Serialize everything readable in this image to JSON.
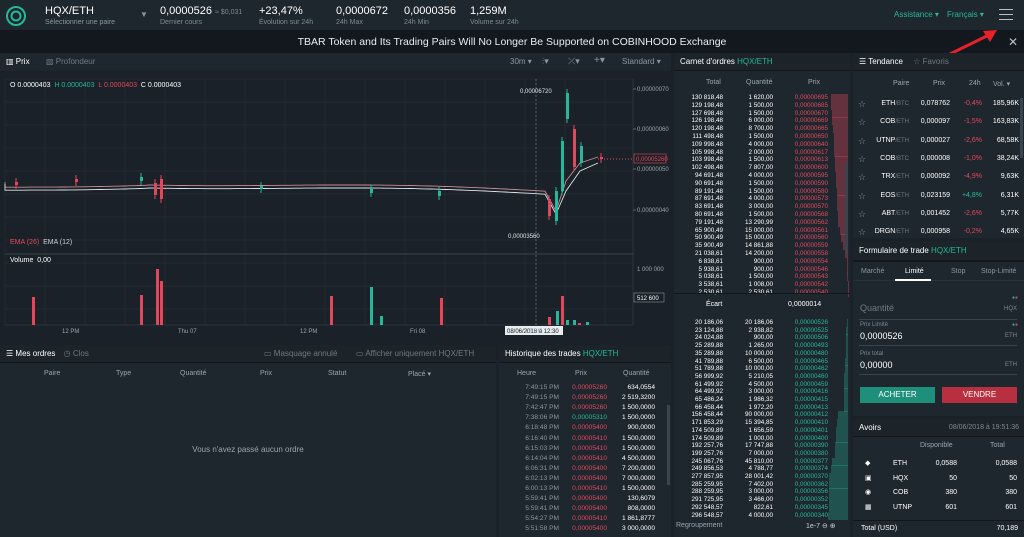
{
  "header": {
    "pair": "HQX/ETH",
    "pair_sub": "Sélectionner une paire",
    "last_price": "0,0000526",
    "last_usd": "≈ $0,031",
    "last_label": "Dernier cours",
    "change": "+23,47%",
    "change_label": "Évolution sur 24h",
    "high": "0,0000672",
    "high_label": "24h Max",
    "low": "0,0000356",
    "low_label": "24h Min",
    "volume": "1,259M",
    "volume_label": "Volume sur 24h",
    "assistance": "Assistance",
    "language": "Français"
  },
  "banner": {
    "text": "TBAR Token and Its Trading Pairs Will No Longer Be Supported on COBINHOOD Exchange",
    "close": "✕"
  },
  "chart": {
    "tab_price": "Prix",
    "tab_depth": "Profondeur",
    "interval": "30m",
    "style": "Standard",
    "ohlc_o": "O 0.0000403",
    "ohlc_h": "H 0.0000403",
    "ohlc_l": "L 0.0000403",
    "ohlc_c": "C 0.0000403",
    "ema26": "EMA (26)",
    "ema12": "EMA (12)",
    "volume_label": "Volume",
    "volume_value": "0,00",
    "price_ticks": [
      "0,00000070",
      "0,00000060",
      "0,00000050",
      "0,00000040"
    ],
    "volume_ticks": [
      "1 000 000",
      "512 600"
    ],
    "peak_label": "0,00006720",
    "low_label": "0,00003560",
    "last_tag": "0,00005260",
    "time_labels": [
      "12 PM",
      "Thu 07",
      "12 PM",
      "Fri 08",
      "12 PM"
    ],
    "cursor_time": "08/06/2018 à 12:30"
  },
  "chart_data": {
    "type": "bar",
    "title": "",
    "categories": [],
    "series": [],
    "values": []
  },
  "orders": {
    "title": "Mes ordres",
    "closed": "Clos",
    "hide_cancelled": "Masquage annulé",
    "only_pair": "Afficher uniquement HQX/ETH",
    "columns": [
      "Paire",
      "Type",
      "Quantité",
      "Prix",
      "Statut",
      "Placé ▾"
    ],
    "empty": "Vous n'avez passé aucun ordre"
  },
  "trades": {
    "title": "Historique des trades",
    "pair": "HQX/ETH",
    "columns": [
      "Heure",
      "Prix",
      "Quantité"
    ],
    "rows": [
      [
        "7:49:15 PM",
        "0,00005260",
        "634,0554",
        "r"
      ],
      [
        "7:49:15 PM",
        "0,00005260",
        "2 519,3200",
        "r"
      ],
      [
        "7:42:47 PM",
        "0,00005260",
        "1 500,0000",
        "r"
      ],
      [
        "7:38:06 PM",
        "0,00005310",
        "1 500,0000",
        "g"
      ],
      [
        "6:18:48 PM",
        "0,00005400",
        "900,0000",
        "r"
      ],
      [
        "6:16:40 PM",
        "0,00005410",
        "1 500,0000",
        "r"
      ],
      [
        "6:15:03 PM",
        "0,00005410",
        "1 500,0000",
        "r"
      ],
      [
        "6:14:04 PM",
        "0,00005410",
        "4 500,0000",
        "r"
      ],
      [
        "6:06:31 PM",
        "0,00005400",
        "7 200,0000",
        "r"
      ],
      [
        "6:02:13 PM",
        "0,00005400",
        "7 000,0000",
        "r"
      ],
      [
        "6:00:13 PM",
        "0,00005410",
        "1 500,0000",
        "r"
      ],
      [
        "5:59:41 PM",
        "0,00005400",
        "130,6079",
        "r"
      ],
      [
        "5:59:41 PM",
        "0,00005400",
        "808,0000",
        "r"
      ],
      [
        "5:54:27 PM",
        "0,00005410",
        "1 861,8777",
        "r"
      ],
      [
        "5:51:58 PM",
        "0,00005400",
        "3 000,0000",
        "r"
      ]
    ]
  },
  "book": {
    "title": "Carnet d'ordres",
    "pair": "HQX/ETH",
    "columns": [
      "Total",
      "Quantité",
      "Prix"
    ],
    "asks": [
      [
        "130 818,48",
        "1 620,00",
        "0,00000695"
      ],
      [
        "129 198,48",
        "1 500,00",
        "0,00000685"
      ],
      [
        "127 698,48",
        "1 500,00",
        "0,00000670"
      ],
      [
        "126 198,48",
        "6 000,00",
        "0,00000669"
      ],
      [
        "120 198,48",
        "8 700,00",
        "0,00000665"
      ],
      [
        "111 498,48",
        "1 500,00",
        "0,00000650"
      ],
      [
        "109 998,48",
        "4 000,00",
        "0,00000640"
      ],
      [
        "105 998,48",
        "2 000,00",
        "0,00000617"
      ],
      [
        "103 998,48",
        "1 500,00",
        "0,00000613"
      ],
      [
        "102 498,48",
        "7 807,00",
        "0,00000600"
      ],
      [
        "94 691,48",
        "4 000,00",
        "0,00000595"
      ],
      [
        "90 691,48",
        "1 500,00",
        "0,00000590"
      ],
      [
        "89 191,48",
        "1 500,00",
        "0,00000580"
      ],
      [
        "87 691,48",
        "4 000,00",
        "0,00000573"
      ],
      [
        "83 691,48",
        "3 000,00",
        "0,00000570"
      ],
      [
        "80 691,48",
        "1 500,00",
        "0,00000568"
      ],
      [
        "79 191,48",
        "13 290,99",
        "0,00000562"
      ],
      [
        "65 900,49",
        "15 000,00",
        "0,00000561"
      ],
      [
        "50 900,49",
        "15 000,00",
        "0,00000560"
      ],
      [
        "35 900,49",
        "14 861,88",
        "0,00000559"
      ],
      [
        "21 038,61",
        "14 200,00",
        "0,00000558"
      ],
      [
        "6 838,61",
        "900,00",
        "0,00000554"
      ],
      [
        "5 938,61",
        "900,00",
        "0,00000546"
      ],
      [
        "5 038,61",
        "1 500,00",
        "0,00000543"
      ],
      [
        "3 538,61",
        "1 008,00",
        "0,00000542"
      ],
      [
        "2 530,61",
        "2 530,61",
        "0,00000540"
      ]
    ],
    "spread_label": "Écart",
    "spread": "0,0000014",
    "bids": [
      [
        "20 186,06",
        "20 186,06",
        "0,00000526"
      ],
      [
        "23 124,88",
        "2 938,82",
        "0,00000525"
      ],
      [
        "24 024,88",
        "900,00",
        "0,00000506"
      ],
      [
        "25 289,88",
        "1 265,00",
        "0,00000493"
      ],
      [
        "35 289,88",
        "10 000,00",
        "0,00000480"
      ],
      [
        "41 789,88",
        "6 500,00",
        "0,00000465"
      ],
      [
        "51 789,88",
        "10 000,00",
        "0,00000462"
      ],
      [
        "56 999,92",
        "5 210,05",
        "0,00000460"
      ],
      [
        "61 499,92",
        "4 500,00",
        "0,00000459"
      ],
      [
        "64 499,92",
        "3 000,00",
        "0,00000416"
      ],
      [
        "65 486,24",
        "1 986,32",
        "0,00000415"
      ],
      [
        "66 458,44",
        "1 972,20",
        "0,00000413"
      ],
      [
        "156 458,44",
        "90 000,00",
        "0,00000412"
      ],
      [
        "171 853,29",
        "15 394,85",
        "0,00000410"
      ],
      [
        "174 509,89",
        "1 656,59",
        "0,00000401"
      ],
      [
        "174 509,89",
        "1 000,00",
        "0,00000400"
      ],
      [
        "192 257,76",
        "17 747,88",
        "0,00000390"
      ],
      [
        "199 257,76",
        "7 000,00",
        "0,00000380"
      ],
      [
        "245 067,76",
        "45 810,00",
        "0,00000377"
      ],
      [
        "249 856,53",
        "4 788,77",
        "0,00000374"
      ],
      [
        "277 857,95",
        "28 001,42",
        "0,00000370"
      ],
      [
        "285 259,95",
        "7 402,00",
        "0,00000362"
      ],
      [
        "288 259,95",
        "3 000,00",
        "0,00000356"
      ],
      [
        "291 725,95",
        "3 466,00",
        "0,00000352"
      ],
      [
        "292 548,57",
        "822,61",
        "0,00000345"
      ],
      [
        "296 548,57",
        "4 000,00",
        "0,00000340"
      ]
    ],
    "grouping_label": "Regroupement",
    "grouping": "1e-7"
  },
  "trend": {
    "title": "Tendance",
    "favorites": "Favoris",
    "columns": [
      "Paire",
      "Prix",
      "24h",
      "Vol. ▾"
    ],
    "rows": [
      [
        "ETH",
        "/BTC",
        "0,078762",
        "-0,4%",
        "185,96K",
        "r"
      ],
      [
        "COB",
        "/ETH",
        "0,000097",
        "-1,5%",
        "163,83K",
        "r"
      ],
      [
        "UTNP",
        "/ETH",
        "0,000027",
        "-2,6%",
        "68,58K",
        "r"
      ],
      [
        "COB",
        "/BTC",
        "0,000008",
        "-1,0%",
        "38,24K",
        "r"
      ],
      [
        "TRX",
        "/ETH",
        "0,000092",
        "-4,9%",
        "9,63K",
        "r"
      ],
      [
        "EOS",
        "/ETH",
        "0,023159",
        "+4,8%",
        "6,31K",
        "g"
      ],
      [
        "ABT",
        "/ETH",
        "0,001452",
        "-2,6%",
        "5,77K",
        "r"
      ],
      [
        "DRGN",
        "/ETH",
        "0,000958",
        "-0,2%",
        "4,65K",
        "r"
      ]
    ]
  },
  "form": {
    "title": "Formulaire de trade",
    "pair": "HQX/ETH",
    "tabs": [
      "Marché",
      "Limité",
      "Stop",
      "Stop-Limité"
    ],
    "qty_placeholder": "Quantité",
    "qty_unit": "HQX",
    "limit_label": "Prix Limité",
    "limit_value": "0,0000526",
    "limit_unit": "ETH",
    "total_label": "Prix total",
    "total_value": "0,00000",
    "total_unit": "ETH",
    "buy": "ACHETER",
    "sell": "VENDRE"
  },
  "assets": {
    "title": "Avoirs",
    "date": "08/06/2018 à 19:51:36",
    "columns": [
      "Disponible",
      "Total"
    ],
    "rows": [
      [
        "ETH",
        "0,0588",
        "0,0588"
      ],
      [
        "HQX",
        "50",
        "50"
      ],
      [
        "COB",
        "380",
        "380"
      ],
      [
        "UTNP",
        "601",
        "601"
      ]
    ],
    "total_label": "Total (USD)",
    "total_value": "70,189"
  }
}
